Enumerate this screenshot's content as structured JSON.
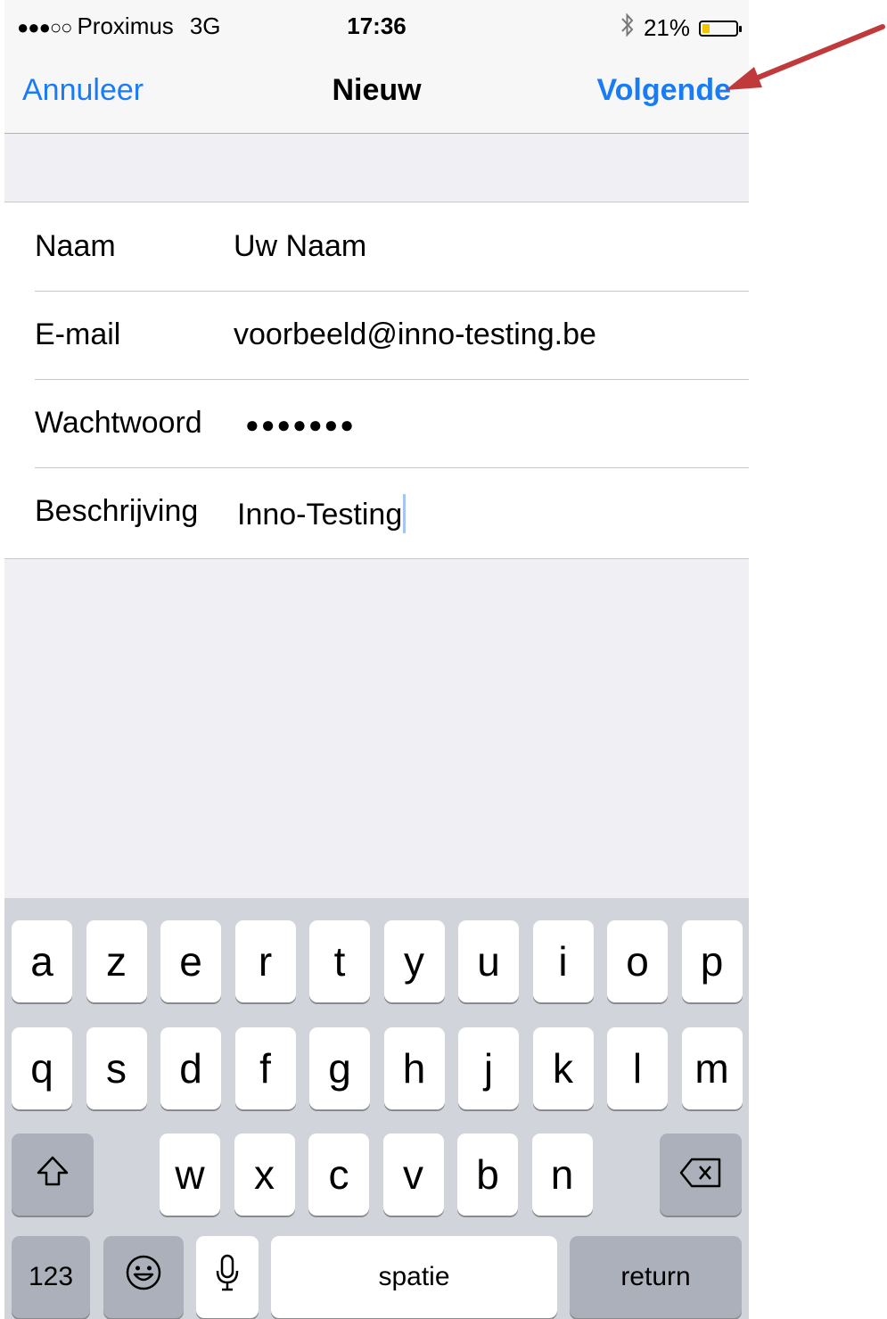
{
  "status_bar": {
    "signal_dots": "●●●○○",
    "carrier": "Proximus",
    "network": "3G",
    "time": "17:36",
    "bluetooth_icon": "bluetooth-icon",
    "battery_percent": "21%",
    "battery_level": 0.21
  },
  "nav": {
    "cancel_label": "Annuleer",
    "title": "Nieuw",
    "next_label": "Volgende",
    "accent_color": "#1a7cf5"
  },
  "form": {
    "rows": [
      {
        "label": "Naam",
        "value": "Uw Naam"
      },
      {
        "label": "E-mail",
        "value": "voorbeeld@inno-testing.be"
      },
      {
        "label": "Wachtwoord",
        "value": "●●●●●●●"
      },
      {
        "label": "Beschrijving",
        "value": "Inno-Testing"
      }
    ]
  },
  "keyboard": {
    "row1": [
      "a",
      "z",
      "e",
      "r",
      "t",
      "y",
      "u",
      "i",
      "o",
      "p"
    ],
    "row2": [
      "q",
      "s",
      "d",
      "f",
      "g",
      "h",
      "j",
      "k",
      "l",
      "m"
    ],
    "row3": [
      "w",
      "x",
      "c",
      "v",
      "b",
      "n"
    ],
    "shift_icon": "shift-icon",
    "delete_icon": "delete-icon",
    "numbers_label": "123",
    "emoji_icon": "emoji-icon",
    "mic_icon": "microphone-icon",
    "space_label": "spatie",
    "return_label": "return"
  },
  "annotation": {
    "arrow_color": "#c0393b"
  }
}
